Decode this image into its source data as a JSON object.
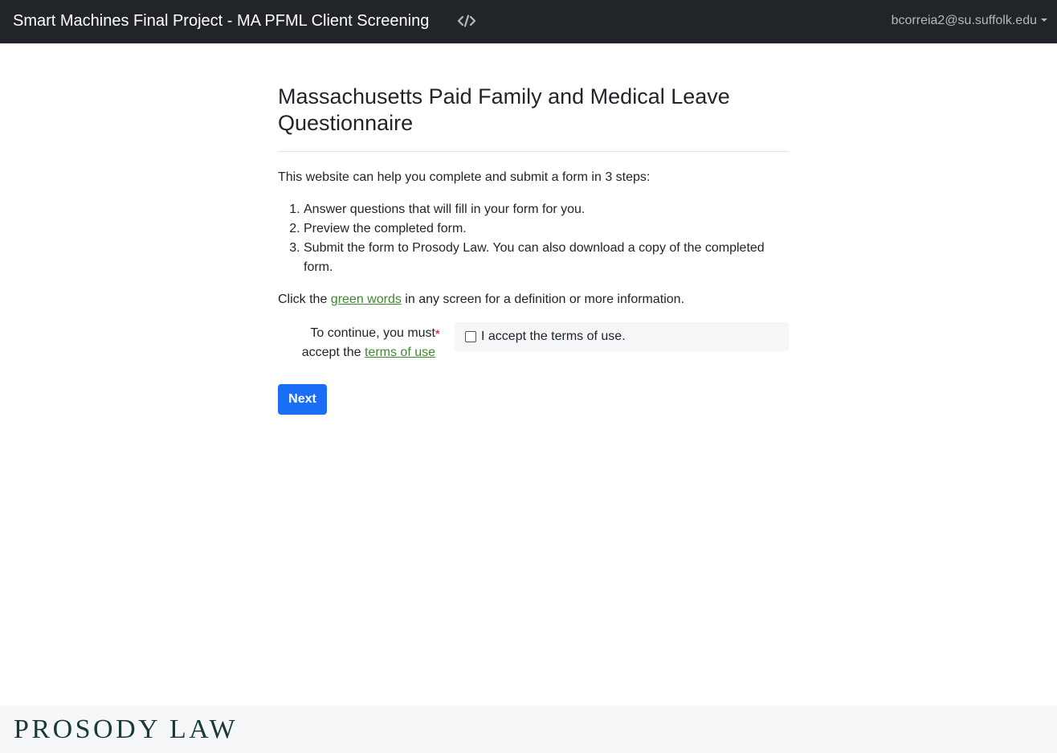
{
  "navbar": {
    "title": "Smart Machines Final Project - MA PFML Client Screening",
    "source_icon": "code-icon",
    "user_email": "bcorreia2@su.suffolk.edu"
  },
  "main": {
    "heading": "Massachusetts Paid Family and Medical Leave Questionnaire",
    "intro": "This website can help you complete and submit a form in 3 steps:",
    "steps": [
      "Answer questions that will fill in your form for you.",
      "Preview the completed form.",
      "Submit the form to Prosody Law. You can also download a copy of the completed form."
    ],
    "hint_prefix": "Click the ",
    "hint_link": "green words",
    "hint_suffix": " in any screen for a definition or more information.",
    "terms_label_prefix": "To continue, you must accept the ",
    "terms_link": "terms of use",
    "required_marker": "*",
    "checkbox_label": "I accept the terms of use.",
    "checkbox_checked": false,
    "next_button": "Next"
  },
  "footer": {
    "logo_text": "PROSODY LAW"
  },
  "colors": {
    "navbar_bg": "#212529",
    "link_green": "#3d8a2e",
    "primary_button": "#1a6ef5",
    "required_red": "#dc3545"
  }
}
